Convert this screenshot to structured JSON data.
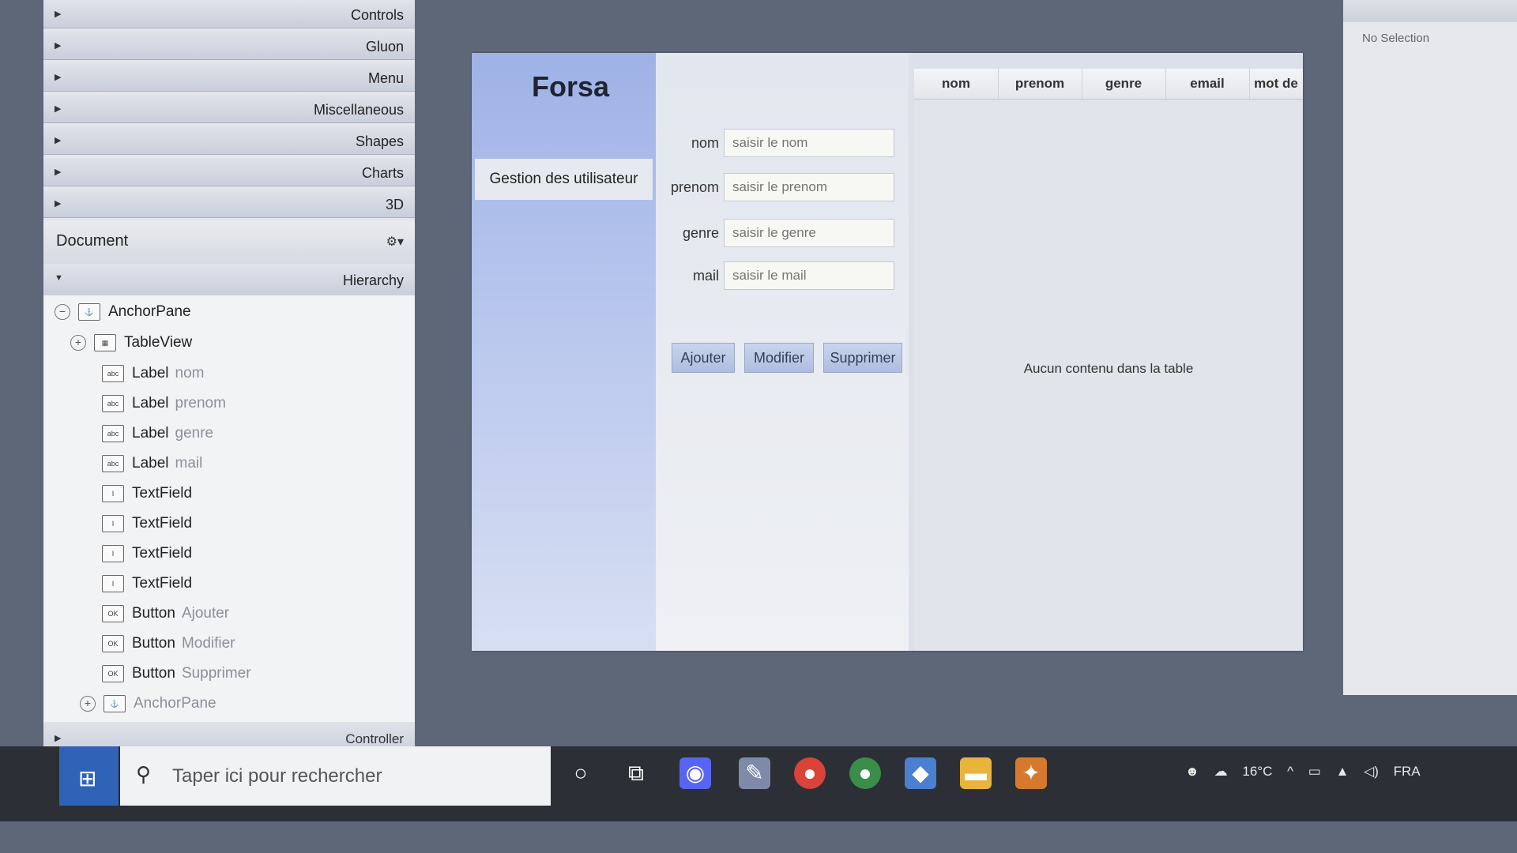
{
  "library": {
    "categories": [
      "Controls",
      "Gluon",
      "Menu",
      "Miscellaneous",
      "Shapes",
      "Charts",
      "3D"
    ]
  },
  "document": {
    "title": "Document",
    "gear_icon": "gear-icon",
    "hierarchy_label": "Hierarchy",
    "tree": [
      {
        "label": "AnchorPane",
        "sub": "",
        "icon": "anchorpane-icon",
        "toggle": "−"
      },
      {
        "label": "TableView",
        "sub": "",
        "icon": "tableview-icon",
        "toggle": "+"
      },
      {
        "label": "Label",
        "sub": "nom",
        "icon": "label-icon"
      },
      {
        "label": "Label",
        "sub": "prenom",
        "icon": "label-icon"
      },
      {
        "label": "Label",
        "sub": "genre",
        "icon": "label-icon"
      },
      {
        "label": "Label",
        "sub": "mail",
        "icon": "label-icon"
      },
      {
        "label": "TextField",
        "sub": "",
        "icon": "textfield-icon"
      },
      {
        "label": "TextField",
        "sub": "",
        "icon": "textfield-icon"
      },
      {
        "label": "TextField",
        "sub": "",
        "icon": "textfield-icon"
      },
      {
        "label": "TextField",
        "sub": "",
        "icon": "textfield-icon"
      },
      {
        "label": "Button",
        "sub": "Ajouter",
        "icon": "button-icon"
      },
      {
        "label": "Button",
        "sub": "Modifier",
        "icon": "button-icon"
      },
      {
        "label": "Button",
        "sub": "Supprimer",
        "icon": "button-icon"
      },
      {
        "label": "AnchorPane",
        "sub": "",
        "icon": "anchorpane-icon",
        "toggle": "+"
      }
    ],
    "controller_label": "Controller"
  },
  "app": {
    "title": "Forsa",
    "nav_item": "Gestion des utilisateur",
    "form": {
      "fields": [
        {
          "label": "nom",
          "placeholder": "saisir le nom"
        },
        {
          "label": "prenom",
          "placeholder": "saisir le prenom"
        },
        {
          "label": "genre",
          "placeholder": "saisir le genre"
        },
        {
          "label": "mail",
          "placeholder": "saisir le mail"
        }
      ],
      "buttons": [
        "Ajouter",
        "Modifier",
        "Supprimer"
      ]
    },
    "table": {
      "columns": [
        "nom",
        "prenom",
        "genre",
        "email",
        "mot de"
      ],
      "empty_message": "Aucun contenu dans la table"
    }
  },
  "inspector": {
    "no_selection": "No Selection"
  },
  "taskbar": {
    "search_placeholder": "Taper ici pour rechercher",
    "apps": [
      "cortana-icon",
      "task-view-icon",
      "discord-icon",
      "paint-icon",
      "chrome-icon",
      "chrome-profile-icon",
      "3d-viewer-icon",
      "file-explorer-icon",
      "scene-builder-icon"
    ],
    "tray": {
      "temperature": "16°C",
      "language": "FRA"
    }
  },
  "colors": {
    "nav_gradient_top": "#9fb2e6",
    "button_blue": "#aebddf",
    "start_blue": "#2f63b8"
  }
}
